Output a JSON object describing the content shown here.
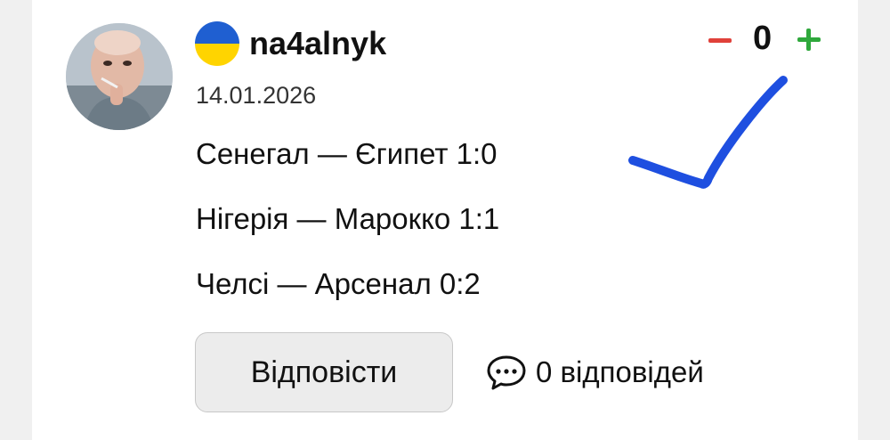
{
  "comment": {
    "author": {
      "username": "na4alnyk",
      "avatar": "avatar-photo",
      "flag": "ukraine-flag-icon",
      "flag_colors": [
        "#1f5fd1",
        "#ffd400"
      ]
    },
    "date": "14.01.2026",
    "lines": [
      "Сенегал — Єгипет 1:0",
      "Нігерія — Марокко 1:1",
      "Челсі — Арсенал 0:2"
    ],
    "rating": {
      "score": "0",
      "minus_icon": "minus-icon",
      "plus_icon": "plus-icon",
      "minus_color": "#e0413a",
      "plus_color": "#2fa83c"
    },
    "annotation": {
      "icon": "checkmark-icon",
      "color": "#1e4fe0"
    },
    "reply_button_label": "Відповісти",
    "replies": {
      "icon": "comment-bubble-icon",
      "text": "0 відповідей"
    }
  }
}
